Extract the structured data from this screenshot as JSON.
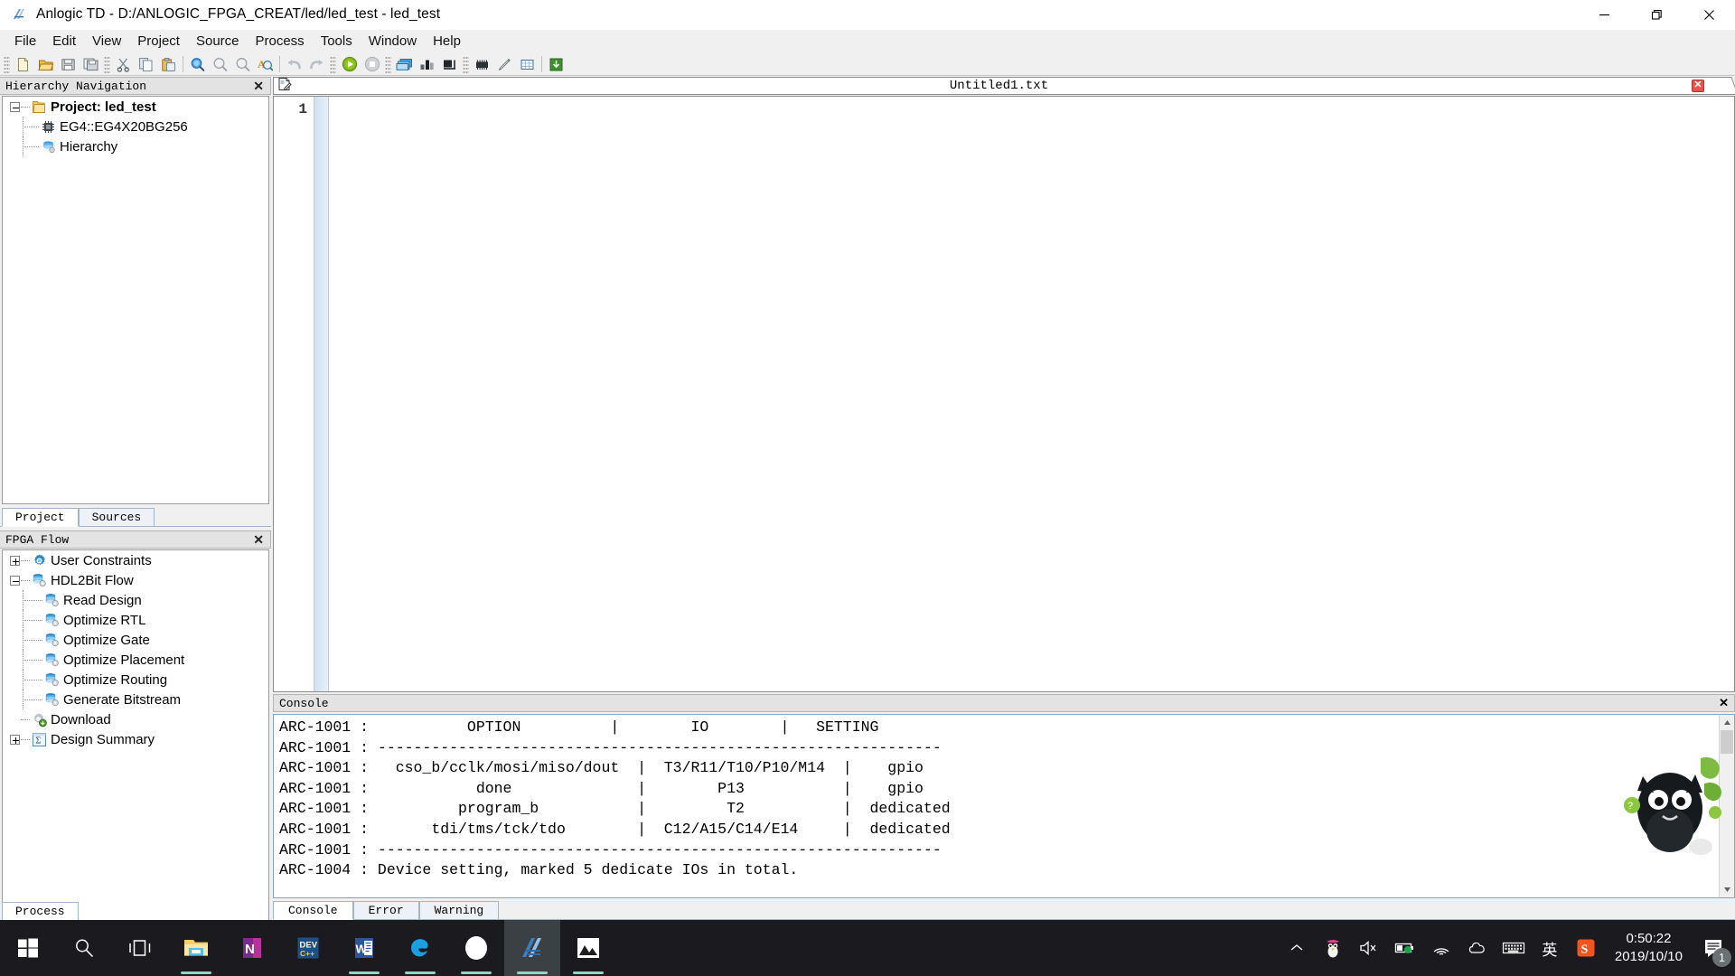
{
  "window": {
    "title": "Anlogic TD - D:/ANLOGIC_FPGA_CREAT/led/led_test - led_test",
    "app_icon": "anlogic-logo-icon",
    "minimize": "—",
    "maximize": "❐",
    "close": "✕"
  },
  "menubar": {
    "items": [
      {
        "label": "File"
      },
      {
        "label": "Edit"
      },
      {
        "label": "View"
      },
      {
        "label": "Project"
      },
      {
        "label": "Source"
      },
      {
        "label": "Process"
      },
      {
        "label": "Tools"
      },
      {
        "label": "Window"
      },
      {
        "label": "Help"
      }
    ]
  },
  "toolbar": {
    "groups": [
      {
        "buttons": [
          {
            "name": "new-file-icon",
            "tip": "New"
          },
          {
            "name": "open-folder-icon",
            "tip": "Open"
          },
          {
            "name": "save-icon",
            "tip": "Save"
          },
          {
            "name": "save-all-icon",
            "tip": "Save All"
          }
        ]
      },
      {
        "buttons": [
          {
            "name": "cut-scissors-icon",
            "tip": "Cut"
          },
          {
            "name": "copy-icon",
            "tip": "Copy"
          },
          {
            "name": "paste-icon",
            "tip": "Paste"
          }
        ]
      },
      {
        "buttons": [
          {
            "name": "zoom-in-icon",
            "tip": "Zoom In"
          },
          {
            "name": "zoom-out-icon",
            "tip": "Zoom Out"
          },
          {
            "name": "zoom-fit-icon",
            "tip": "Zoom Fit"
          },
          {
            "name": "find-text-icon",
            "tip": "Find"
          }
        ]
      },
      {
        "buttons": [
          {
            "name": "undo-icon",
            "tip": "Undo"
          },
          {
            "name": "redo-icon",
            "tip": "Redo"
          }
        ]
      },
      {
        "buttons": [
          {
            "name": "run-icon",
            "tip": "Run"
          },
          {
            "name": "stop-icon",
            "tip": "Stop"
          }
        ]
      },
      {
        "buttons": [
          {
            "name": "windows-cascade-icon",
            "tip": "Cascade"
          },
          {
            "name": "report-chart-icon",
            "tip": "Report"
          },
          {
            "name": "floorplan-icon",
            "tip": "Floorplan"
          }
        ]
      },
      {
        "buttons": [
          {
            "name": "device-chip-icon",
            "tip": "Device"
          },
          {
            "name": "pencil-icon",
            "tip": "Edit"
          },
          {
            "name": "grid-icon",
            "tip": "Grid"
          }
        ]
      },
      {
        "buttons": [
          {
            "name": "download-icon",
            "tip": "Download"
          }
        ]
      }
    ]
  },
  "hierarchy_panel": {
    "title": "Hierarchy Navigation",
    "close_icon": "✕",
    "tree": [
      {
        "label": "Project: led_test",
        "icon": "folder-icon",
        "depth": 0,
        "expander": "minus",
        "bold": true
      },
      {
        "label": "EG4::EG4X20BG256",
        "icon": "chip-icon",
        "depth": 1,
        "expander": "none",
        "bold": false
      },
      {
        "label": "Hierarchy",
        "icon": "hierarchy-icon",
        "depth": 1,
        "expander": "none",
        "bold": false
      }
    ],
    "tabs": [
      {
        "label": "Project",
        "active": true
      },
      {
        "label": "Sources",
        "active": false
      }
    ]
  },
  "fpga_flow_panel": {
    "title": "FPGA Flow",
    "close_icon": "✕",
    "tree": [
      {
        "label": "User Constraints",
        "icon": "gear-blue-icon",
        "depth": 0,
        "expander": "plus"
      },
      {
        "label": "HDL2Bit Flow",
        "icon": "flow-stack-icon",
        "depth": 0,
        "expander": "minus"
      },
      {
        "label": "Read Design",
        "icon": "flow-stack-icon",
        "depth": 1,
        "expander": "none"
      },
      {
        "label": "Optimize RTL",
        "icon": "flow-stack-icon",
        "depth": 1,
        "expander": "none"
      },
      {
        "label": "Optimize Gate",
        "icon": "flow-stack-icon",
        "depth": 1,
        "expander": "none"
      },
      {
        "label": "Optimize Placement",
        "icon": "flow-stack-icon",
        "depth": 1,
        "expander": "none"
      },
      {
        "label": "Optimize Routing",
        "icon": "flow-stack-icon",
        "depth": 1,
        "expander": "none"
      },
      {
        "label": "Generate Bitstream",
        "icon": "flow-stack-icon",
        "depth": 1,
        "expander": "none"
      },
      {
        "label": "Download",
        "icon": "download-gear-icon",
        "depth": 0,
        "expander": "none"
      },
      {
        "label": "Design Summary",
        "icon": "sigma-icon",
        "depth": 0,
        "expander": "plus"
      }
    ],
    "bottom_tab": "Process"
  },
  "editor": {
    "tab_name": "Untitled1.txt",
    "tab_icon": "text-document-icon",
    "tab_close": "✕",
    "line_numbers": [
      "1"
    ],
    "content": ""
  },
  "console": {
    "title": "Console",
    "close_icon": "✕",
    "lines": [
      "ARC-1001 :           OPTION          |        IO        |   SETTING",
      "ARC-1001 : ---------------------------------------------------------------",
      "ARC-1001 :   cso_b/cclk/mosi/miso/dout  |  T3/R11/T10/P10/M14  |    gpio",
      "ARC-1001 :            done              |        P13           |    gpio",
      "ARC-1001 :          program_b           |         T2           |  dedicated",
      "ARC-1001 :       tdi/tms/tck/tdo        |  C12/A15/C14/E14     |  dedicated",
      "ARC-1001 : ---------------------------------------------------------------",
      "ARC-1004 : Device setting, marked 5 dedicate IOs in total."
    ],
    "tabs": [
      {
        "label": "Console",
        "active": true
      },
      {
        "label": "Error",
        "active": false
      },
      {
        "label": "Warning",
        "active": false
      }
    ]
  },
  "taskbar": {
    "start": "windows-start-icon",
    "items": [
      {
        "name": "search-icon",
        "active": false,
        "running": false
      },
      {
        "name": "task-view-icon",
        "active": false,
        "running": false
      },
      {
        "name": "file-explorer-icon",
        "active": false,
        "running": true
      },
      {
        "name": "onenote-icon",
        "active": false,
        "running": false
      },
      {
        "name": "devcpp-icon",
        "active": false,
        "running": false
      },
      {
        "name": "word-icon",
        "active": false,
        "running": true
      },
      {
        "name": "edge-icon",
        "active": false,
        "running": true
      },
      {
        "name": "circle-app-icon",
        "active": false,
        "running": true
      },
      {
        "name": "anlogic-td-icon",
        "active": true,
        "running": true
      },
      {
        "name": "photos-icon",
        "active": false,
        "running": true
      }
    ],
    "tray": [
      {
        "name": "show-hidden-icons-chevron"
      },
      {
        "name": "qq-penguin-icon"
      },
      {
        "name": "volume-muted-icon"
      },
      {
        "name": "battery-icon"
      },
      {
        "name": "wifi-icon"
      },
      {
        "name": "onedrive-icon"
      },
      {
        "name": "touch-keyboard-icon"
      },
      {
        "name": "ime-english-icon"
      },
      {
        "name": "sogou-input-icon"
      }
    ],
    "clock_time": "0:50:22",
    "clock_date": "2019/10/10",
    "notification_count": "1"
  },
  "colors": {
    "titlebar_bg": "#ffffff",
    "chrome_bg": "#f0f0f0",
    "panel_header": "#e3e3e3",
    "taskbar_bg": "#1b1b1f",
    "accent_blue": "#2f7fd0",
    "run_green": "#6aae1e",
    "close_red": "#e8544a"
  }
}
